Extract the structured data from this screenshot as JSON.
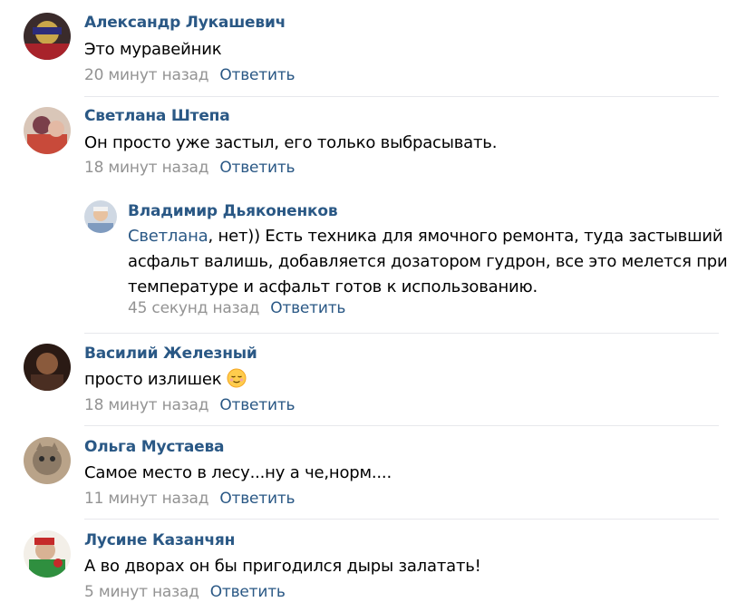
{
  "comments": [
    {
      "author": "Александр Лукашевич",
      "text": "Это муравейник",
      "time": "20 минут назад",
      "reply_label": "Ответить"
    },
    {
      "author": "Светлана Штепа",
      "text": "Он просто уже застыл, его только выбрасывать.",
      "time": "18 минут назад",
      "reply_label": "Ответить",
      "replies": [
        {
          "author": "Владимир Дьяконенков",
          "mention": "Светлана",
          "text_lines": [
            ", нет)) Есть техника для ямочного ремонта, туда застывший",
            "асфальт валишь, добавляется дозатором гудрон, все это мелется при",
            "температуре и асфальт готов к использованию."
          ],
          "time": "45 секунд назад",
          "reply_label": "Ответить"
        }
      ]
    },
    {
      "author": "Василий Железный",
      "text": "просто излишек",
      "emoji": "relieved-face",
      "time": "18 минут назад",
      "reply_label": "Ответить"
    },
    {
      "author": "Ольга Мустаева",
      "text": "Самое место в лесу...ну а че,норм....",
      "time": "11 минут назад",
      "reply_label": "Ответить"
    },
    {
      "author": "Лусине Казанчян",
      "text": "А во дворах он бы пригодился дыры залатать!",
      "time": "5 минут назад",
      "reply_label": "Ответить"
    }
  ],
  "colors": {
    "author_link": "#2a5885",
    "meta_gray": "#939393",
    "separator": "#e7e8ec"
  }
}
